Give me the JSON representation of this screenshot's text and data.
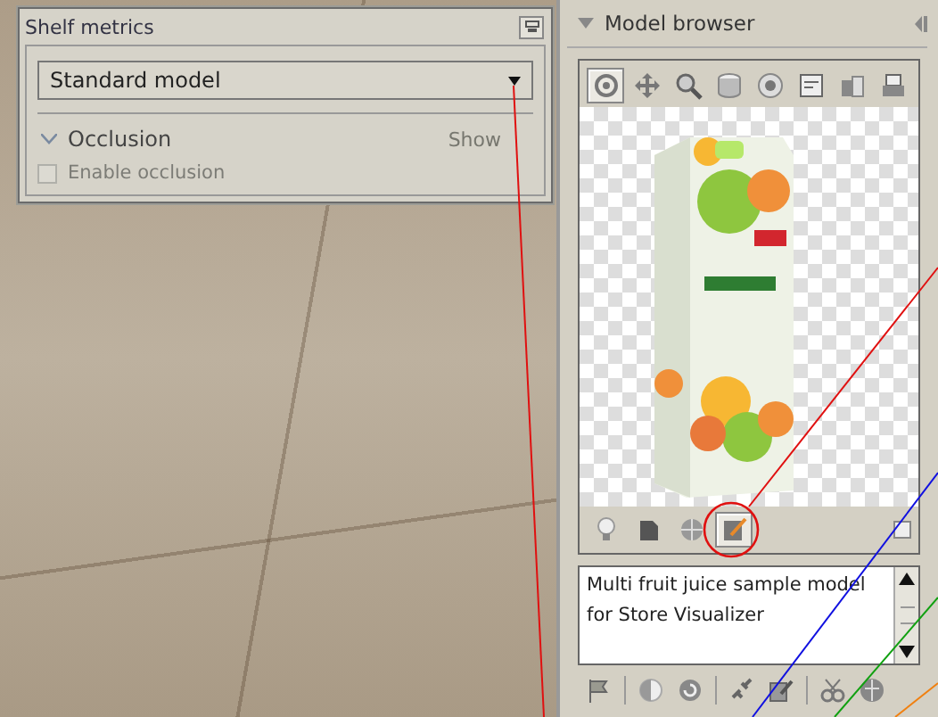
{
  "shelf_metrics": {
    "title": "Shelf metrics",
    "model_dropdown": {
      "value": "Standard model"
    },
    "occlusion": {
      "title": "Occlusion",
      "expanded": true,
      "action": "Show"
    },
    "enable_occlusion": {
      "label": "Enable occlusion",
      "checked": false,
      "disabled": true
    }
  },
  "model_browser": {
    "title": "Model browser",
    "expanded": true,
    "view_tools": [
      {
        "selected": true
      },
      {
        "selected": false
      },
      {
        "selected": false
      },
      {
        "selected": false
      },
      {
        "selected": false
      },
      {
        "selected": false
      },
      {
        "selected": false
      },
      {
        "selected": false
      }
    ],
    "display_modes": [
      {
        "selected": false
      },
      {
        "selected": false
      },
      {
        "selected": false
      },
      {
        "selected": true
      }
    ],
    "description": "Multi fruit juice sample model for Store Visualizer"
  }
}
